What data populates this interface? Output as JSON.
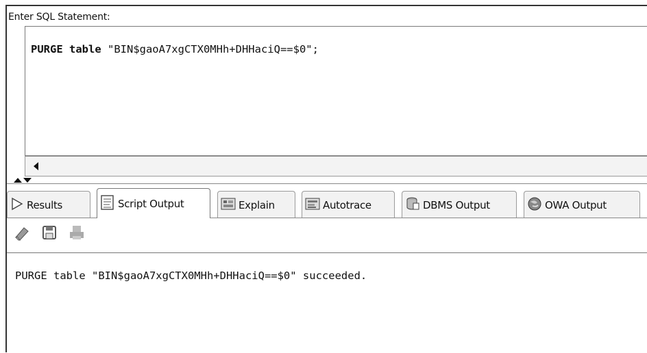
{
  "editor": {
    "label": "Enter SQL Statement:",
    "sql_keyword": "PURGE table",
    "sql_rest": " \"BIN$gaoA7xgCTX0MHh+DHHaciQ==$0\";"
  },
  "tabs": [
    {
      "label": "Results",
      "icon": "play-triangle-icon"
    },
    {
      "label": "Script Output",
      "icon": "script-document-icon"
    },
    {
      "label": "Explain",
      "icon": "explain-plan-icon"
    },
    {
      "label": "Autotrace",
      "icon": "autotrace-icon"
    },
    {
      "label": "DBMS Output",
      "icon": "dbms-output-icon"
    },
    {
      "label": "OWA Output",
      "icon": "owa-globe-icon"
    }
  ],
  "toolbar": {
    "clear_icon": "eraser-icon",
    "save_icon": "save-disk-icon",
    "print_icon": "print-icon"
  },
  "output": {
    "text": "PURGE table \"BIN$gaoA7xgCTX0MHh+DHHaciQ==$0\" succeeded."
  }
}
